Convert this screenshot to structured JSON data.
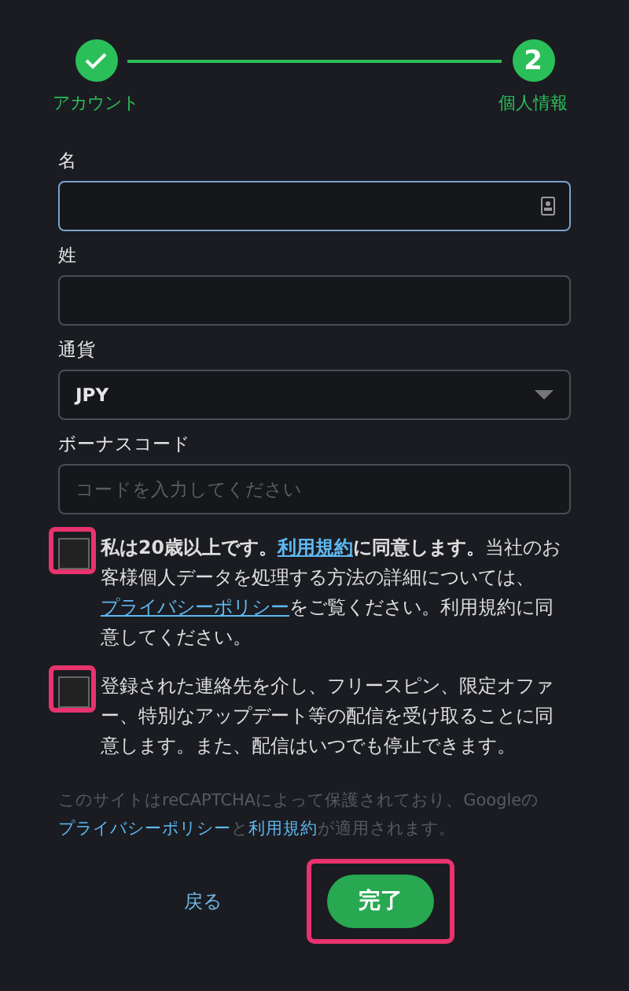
{
  "stepper": {
    "steps": [
      {
        "label": "アカウント",
        "done": true
      },
      {
        "label": "個人情報",
        "number": "2",
        "done": false
      }
    ]
  },
  "fields": [
    {
      "kind": "text",
      "label": "名",
      "focused": true,
      "autofill_icon": true
    },
    {
      "kind": "text",
      "label": "姓",
      "focused": false
    },
    {
      "kind": "select",
      "label": "通貨",
      "value": "JPY",
      "focused": false
    },
    {
      "kind": "text",
      "label": "ボーナスコード",
      "placeholder": "コードを入力してください",
      "focused": false
    }
  ],
  "consents": [
    {
      "checked": false,
      "highlighted": true,
      "parts": [
        {
          "kind": "text",
          "text": "**私は20歳以上です。**"
        },
        {
          "kind": "link",
          "text": "**利用規約**"
        },
        {
          "kind": "text",
          "text": "**に同意します。**当社のお客様個人データを処理する方法の詳細については、"
        },
        {
          "kind": "link",
          "text": "プライバシーポリシー"
        },
        {
          "kind": "text",
          "text": "をご覧ください。利用規約に同意してください。"
        }
      ]
    },
    {
      "checked": false,
      "highlighted": true,
      "parts": [
        {
          "kind": "text",
          "text": "登録された連絡先を介し、フリースピン、限定オファー、特別なアップデート等の配信を受け取ることに同意します。また、配信はいつでも停止できます。"
        }
      ]
    }
  ],
  "recaptcha_note": [
    {
      "kind": "text",
      "text": "このサイトはreCAPTCHAによって保護されており、Googleの"
    },
    {
      "kind": "link",
      "text": "プライバシーポリシー"
    },
    {
      "kind": "text",
      "text": "と"
    },
    {
      "kind": "link",
      "text": "利用規約"
    },
    {
      "kind": "text",
      "text": "が適用されます。"
    }
  ],
  "actions": {
    "back": "戻る",
    "submit": "完了",
    "submit_highlighted": true
  }
}
